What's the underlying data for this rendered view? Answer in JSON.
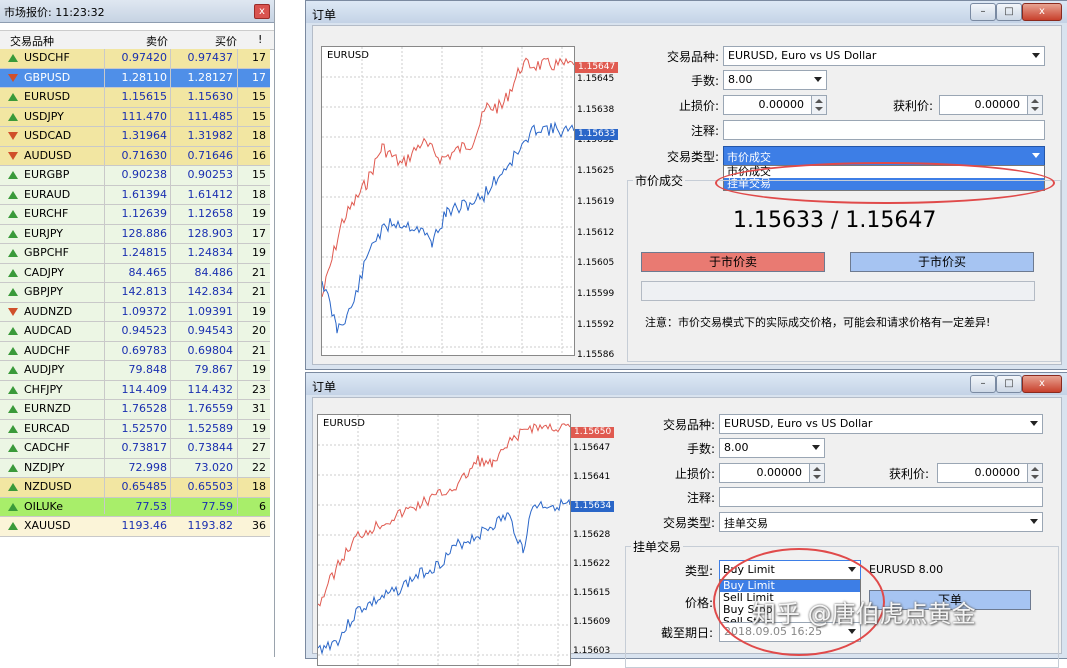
{
  "market_watch": {
    "title": "市场报价: 11:23:32",
    "close": "x",
    "headers": {
      "symbol": "交易品种",
      "bid": "卖价",
      "ask": "买价",
      "spread": "!"
    },
    "rows": [
      {
        "symbol": "USDCHF",
        "bid": "0.97420",
        "ask": "0.97437",
        "spread": "17",
        "dir": "up",
        "bg": "#f2e6a2"
      },
      {
        "symbol": "GBPUSD",
        "bid": "1.28110",
        "ask": "1.28127",
        "spread": "17",
        "dir": "dn",
        "bg": "#4f8fe8",
        "selected": true
      },
      {
        "symbol": "EURUSD",
        "bid": "1.15615",
        "ask": "1.15630",
        "spread": "15",
        "dir": "up",
        "bg": "#f2e6a2"
      },
      {
        "symbol": "USDJPY",
        "bid": "111.470",
        "ask": "111.485",
        "spread": "15",
        "dir": "up",
        "bg": "#f2e6a2"
      },
      {
        "symbol": "USDCAD",
        "bid": "1.31964",
        "ask": "1.31982",
        "spread": "18",
        "dir": "dn",
        "bg": "#f2e6a2"
      },
      {
        "symbol": "AUDUSD",
        "bid": "0.71630",
        "ask": "0.71646",
        "spread": "16",
        "dir": "dn",
        "bg": "#f2e6a2"
      },
      {
        "symbol": "EURGBP",
        "bid": "0.90238",
        "ask": "0.90253",
        "spread": "15",
        "dir": "up",
        "bg": "#ecf6e4"
      },
      {
        "symbol": "EURAUD",
        "bid": "1.61394",
        "ask": "1.61412",
        "spread": "18",
        "dir": "up",
        "bg": "#ecf6e4"
      },
      {
        "symbol": "EURCHF",
        "bid": "1.12639",
        "ask": "1.12658",
        "spread": "19",
        "dir": "up",
        "bg": "#ecf6e4"
      },
      {
        "symbol": "EURJPY",
        "bid": "128.886",
        "ask": "128.903",
        "spread": "17",
        "dir": "up",
        "bg": "#ecf6e4"
      },
      {
        "symbol": "GBPCHF",
        "bid": "1.24815",
        "ask": "1.24834",
        "spread": "19",
        "dir": "up",
        "bg": "#ecf6e4"
      },
      {
        "symbol": "CADJPY",
        "bid": "84.465",
        "ask": "84.486",
        "spread": "21",
        "dir": "up",
        "bg": "#ecf6e4"
      },
      {
        "symbol": "GBPJPY",
        "bid": "142.813",
        "ask": "142.834",
        "spread": "21",
        "dir": "up",
        "bg": "#ecf6e4"
      },
      {
        "symbol": "AUDNZD",
        "bid": "1.09372",
        "ask": "1.09391",
        "spread": "19",
        "dir": "dn",
        "bg": "#ecf6e4"
      },
      {
        "symbol": "AUDCAD",
        "bid": "0.94523",
        "ask": "0.94543",
        "spread": "20",
        "dir": "up",
        "bg": "#ecf6e4"
      },
      {
        "symbol": "AUDCHF",
        "bid": "0.69783",
        "ask": "0.69804",
        "spread": "21",
        "dir": "up",
        "bg": "#ecf6e4"
      },
      {
        "symbol": "AUDJPY",
        "bid": "79.848",
        "ask": "79.867",
        "spread": "19",
        "dir": "up",
        "bg": "#ecf6e4"
      },
      {
        "symbol": "CHFJPY",
        "bid": "114.409",
        "ask": "114.432",
        "spread": "23",
        "dir": "up",
        "bg": "#ecf6e4"
      },
      {
        "symbol": "EURNZD",
        "bid": "1.76528",
        "ask": "1.76559",
        "spread": "31",
        "dir": "up",
        "bg": "#ecf6e4"
      },
      {
        "symbol": "EURCAD",
        "bid": "1.52570",
        "ask": "1.52589",
        "spread": "19",
        "dir": "up",
        "bg": "#ecf6e4"
      },
      {
        "symbol": "CADCHF",
        "bid": "0.73817",
        "ask": "0.73844",
        "spread": "27",
        "dir": "up",
        "bg": "#ecf6e4"
      },
      {
        "symbol": "NZDJPY",
        "bid": "72.998",
        "ask": "73.020",
        "spread": "22",
        "dir": "up",
        "bg": "#ecf6e4"
      },
      {
        "symbol": "NZDUSD",
        "bid": "0.65485",
        "ask": "0.65503",
        "spread": "18",
        "dir": "up",
        "bg": "#f2e6a2"
      },
      {
        "symbol": "OILUKe",
        "bid": "77.53",
        "ask": "77.59",
        "spread": "6",
        "dir": "up",
        "bg": "#a8ee6a"
      },
      {
        "symbol": "XAUUSD",
        "bid": "1193.46",
        "ask": "1193.82",
        "spread": "36",
        "dir": "up",
        "bg": "#fbf4d8"
      }
    ]
  },
  "order1": {
    "title": "订单",
    "chart_symbol": "EURUSD",
    "ticks": [
      "1.15645",
      "1.15638",
      "1.15632",
      "1.15625",
      "1.15619",
      "1.15612",
      "1.15605",
      "1.15599",
      "1.15592",
      "1.15586"
    ],
    "ask_tag": "1.15647",
    "bid_tag": "1.15633",
    "labels": {
      "symbol": "交易品种:",
      "volume": "手数:",
      "sl": "止损价:",
      "tp": "获利价:",
      "comment": "注释:",
      "type": "交易类型:"
    },
    "symbol_value": "EURUSD, Euro vs US Dollar",
    "volume_value": "8.00",
    "sl_value": "0.00000",
    "tp_value": "0.00000",
    "type_value": "市价成交",
    "dropdown": [
      "市价成交",
      "挂单交易"
    ],
    "group_label": "市价成交",
    "price_display": "1.15633 / 1.15647",
    "sell_label": "于市价卖",
    "buy_label": "于市价买",
    "note": "注意：市价交易模式下的实际成交价格，可能会和请求价格有一定差异!"
  },
  "order2": {
    "title": "订单",
    "chart_symbol": "EURUSD",
    "ticks": [
      "1.15647",
      "1.15641",
      "1.15634",
      "1.15628",
      "1.15622",
      "1.15615",
      "1.15609",
      "1.15603"
    ],
    "ask_tag": "1.15650",
    "bid_tag": "1.15634",
    "labels": {
      "symbol": "交易品种:",
      "volume": "手数:",
      "sl": "止损价:",
      "tp": "获利价:",
      "comment": "注释:",
      "type": "交易类型:"
    },
    "symbol_value": "EURUSD, Euro vs US Dollar",
    "volume_value": "8.00",
    "sl_value": "0.00000",
    "tp_value": "0.00000",
    "type_value": "挂单交易",
    "group_label": "挂单交易",
    "pending_type_label": "类型:",
    "pending_type_value": "Buy Limit",
    "pending_dropdown": [
      "Buy Limit",
      "Sell Limit",
      "Buy Stop",
      "Sell Stop"
    ],
    "pending_info": "EURUSD 8.00",
    "price_label": "价格:",
    "expiry_label": "截至期日:",
    "expiry_value": "2018.09.05 16:25",
    "place_label": "下单"
  },
  "watermark": "知乎 @唐伯虎点黄金",
  "colors": {
    "ask_line": "#e05a50",
    "bid_line": "#2a66c8",
    "ellipse": "#e04a4a"
  }
}
